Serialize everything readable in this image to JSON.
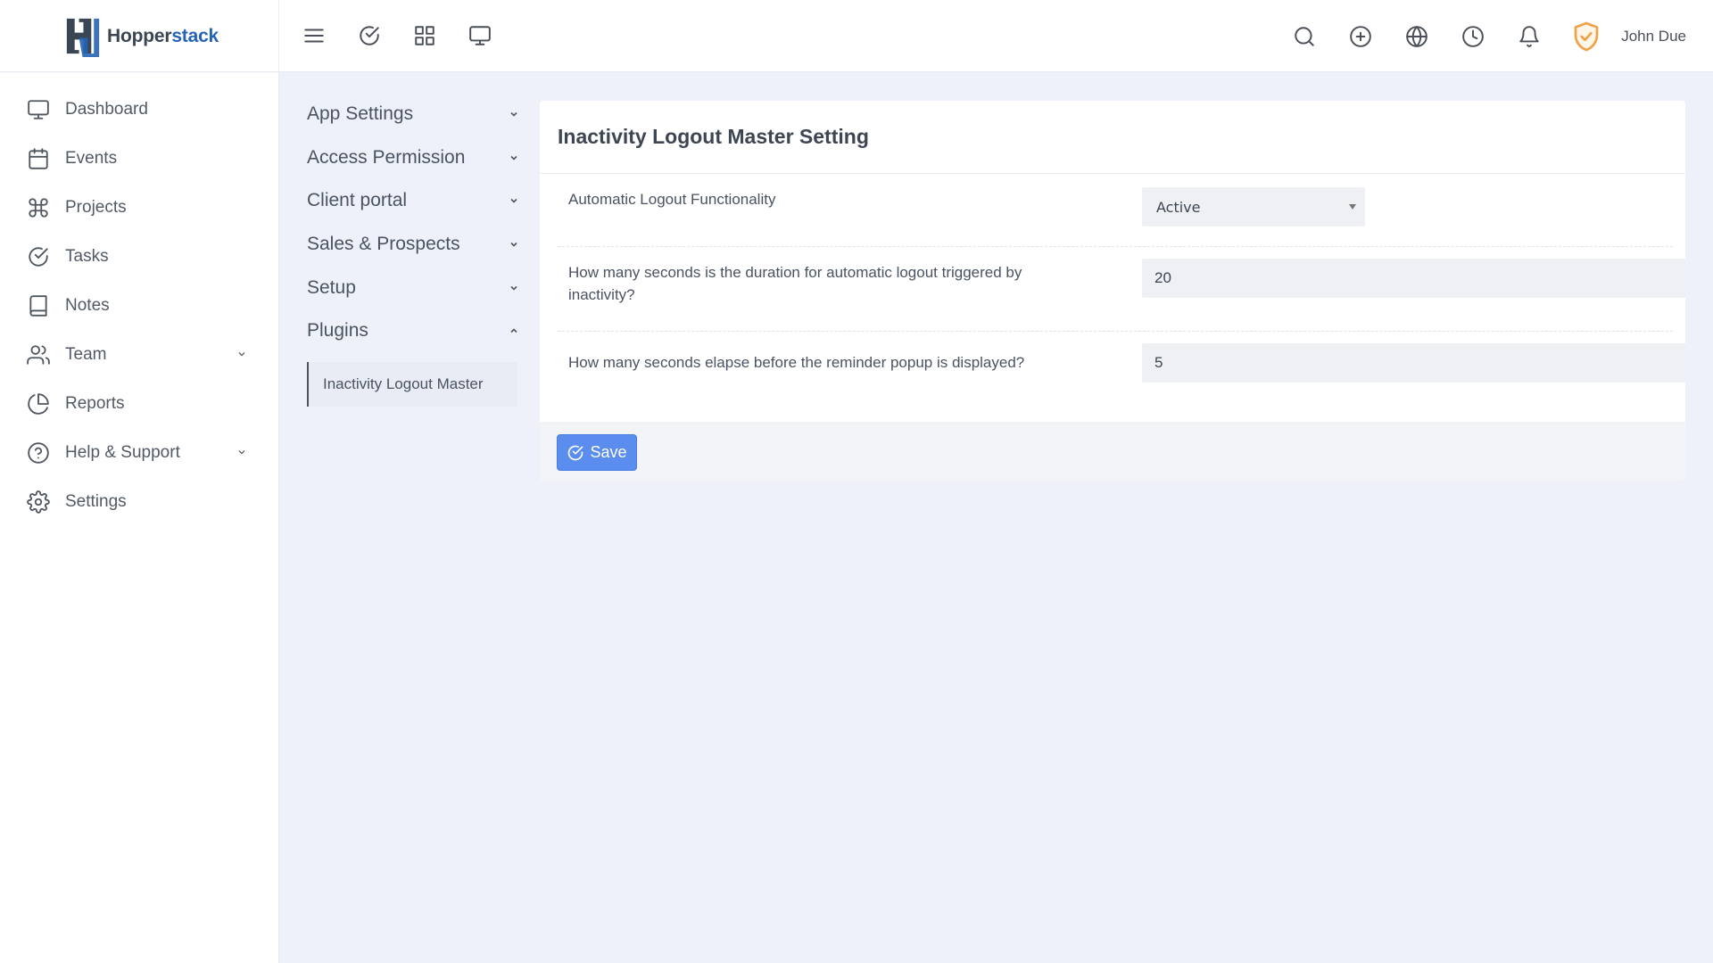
{
  "brand": {
    "name_part1": "Hopper",
    "name_part2": "stack",
    "icon": "hopperstack-logo"
  },
  "header": {
    "left_icons": [
      "menu-icon",
      "check-circle-icon",
      "grid-icon",
      "monitor-icon"
    ],
    "right_icons": [
      "search-icon",
      "plus-circle-icon",
      "globe-icon",
      "clock-icon",
      "bell-icon"
    ],
    "user_badge_icon": "shield-check-icon",
    "user_badge_color": "#f0a24a",
    "user_name": "John Due"
  },
  "sidebar": {
    "items": [
      {
        "label": "Dashboard",
        "icon": "monitor-icon"
      },
      {
        "label": "Events",
        "icon": "calendar-icon"
      },
      {
        "label": "Projects",
        "icon": "command-icon"
      },
      {
        "label": "Tasks",
        "icon": "check-circle-icon"
      },
      {
        "label": "Notes",
        "icon": "book-icon"
      },
      {
        "label": "Team",
        "icon": "users-icon",
        "has_submenu": true
      },
      {
        "label": "Reports",
        "icon": "pie-chart-icon"
      },
      {
        "label": "Help & Support",
        "icon": "help-circle-icon",
        "has_submenu": true
      },
      {
        "label": "Settings",
        "icon": "gear-icon"
      }
    ]
  },
  "settings_menu": {
    "items": [
      {
        "label": "App Settings",
        "expanded": false
      },
      {
        "label": "Access Permission",
        "expanded": false
      },
      {
        "label": "Client portal",
        "expanded": false
      },
      {
        "label": "Sales & Prospects",
        "expanded": false
      },
      {
        "label": "Setup",
        "expanded": false
      },
      {
        "label": "Plugins",
        "expanded": true
      }
    ],
    "active_subitem": "Inactivity Logout Master"
  },
  "card": {
    "title": "Inactivity Logout Master Setting",
    "fields": {
      "auto_logout": {
        "label": "Automatic Logout Functionality",
        "value": "Active"
      },
      "duration": {
        "label": "How many seconds is the duration for automatic logout triggered by inactivity?",
        "value": "20"
      },
      "reminder": {
        "label": "How many seconds elapse before the reminder popup is displayed?",
        "value": "5"
      }
    },
    "save_label": "Save",
    "accent_color": "#5b8def"
  }
}
